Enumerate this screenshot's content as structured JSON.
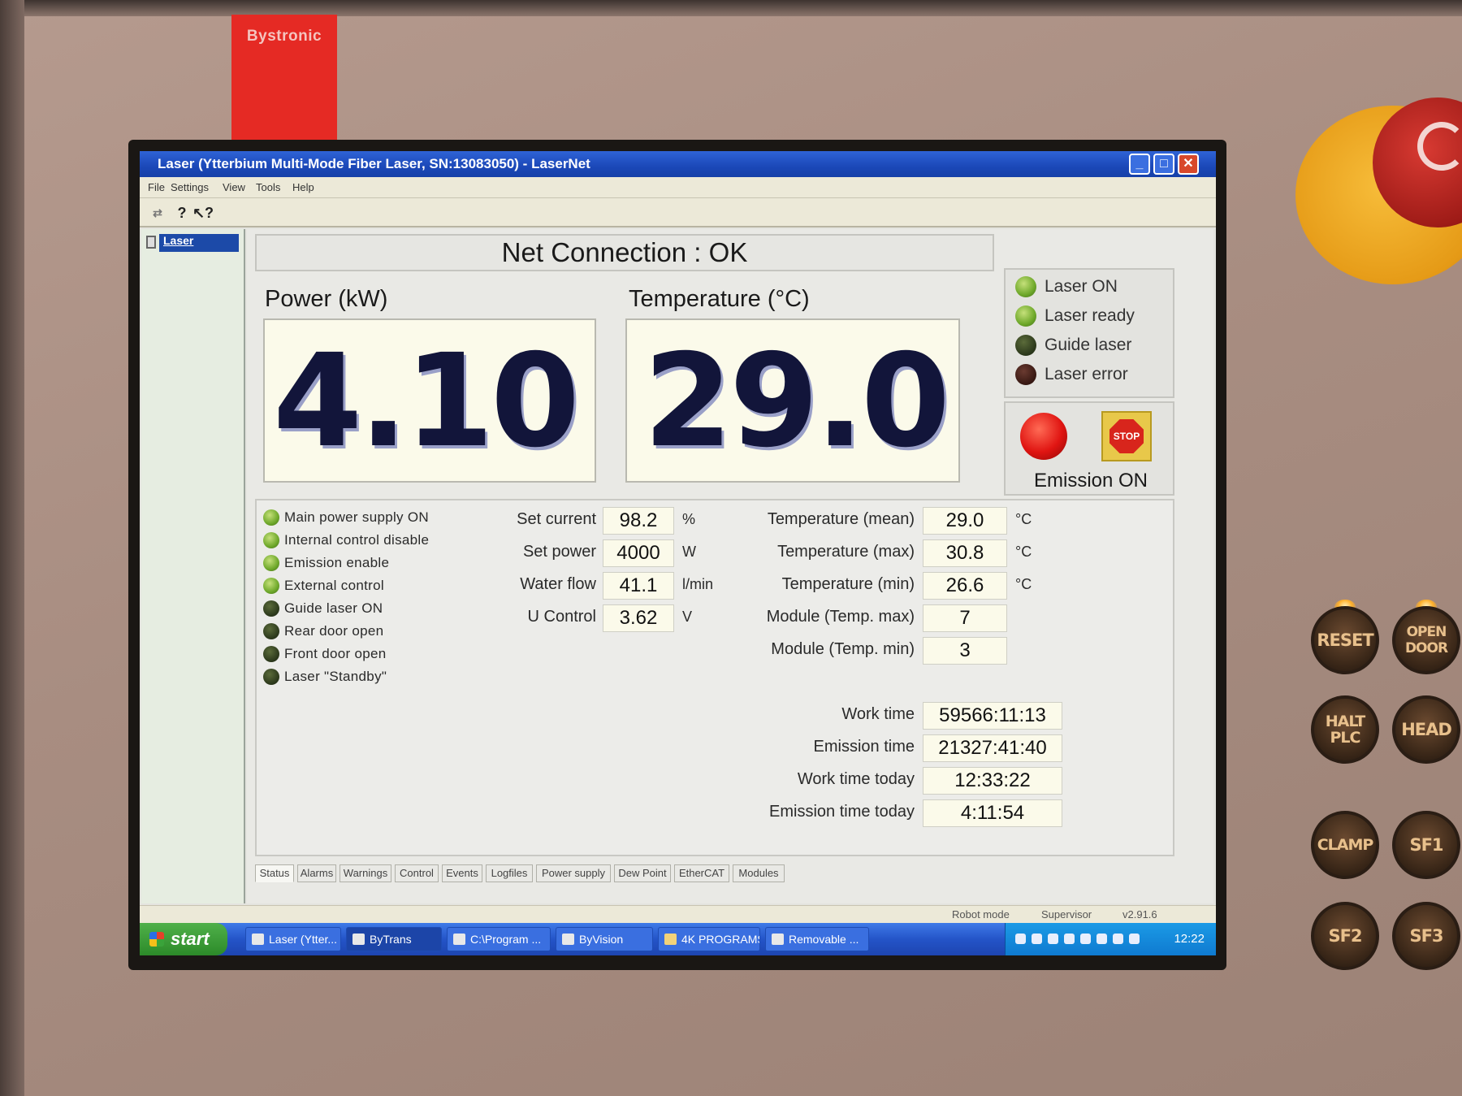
{
  "hardware": {
    "brand": "Bystronic",
    "buttons": [
      {
        "name": "reset-button",
        "label": "RESET"
      },
      {
        "name": "open-door-button",
        "label": "OPEN DOOR"
      },
      {
        "name": "halt-plc-button",
        "label": "HALT PLC"
      },
      {
        "name": "head-button",
        "label": "HEAD"
      },
      {
        "name": "clamp-button",
        "label": "CLAMP"
      },
      {
        "name": "sf1-button",
        "label": "SF1"
      },
      {
        "name": "sf2-button",
        "label": "SF2"
      },
      {
        "name": "sf3-button",
        "label": "SF3"
      }
    ]
  },
  "window": {
    "title": "Laser (Ytterbium Multi-Mode Fiber Laser, SN:13083050) - LaserNet",
    "controls": {
      "minimize": "_",
      "maximize": "□",
      "close": "✕"
    }
  },
  "menu": [
    "File",
    "Settings",
    "View",
    "Tools",
    "Help"
  ],
  "toolbar_icons": [
    "connect-icon",
    "help-icon",
    "context-help-icon"
  ],
  "tree": {
    "item": "Laser"
  },
  "main": {
    "net_connection": "Net Connection : OK",
    "power_label": "Power (kW)",
    "power_value": "4.10",
    "temperature_label": "Temperature (°C)",
    "temperature_value": "29.0",
    "status_indicators": [
      {
        "label": "Laser ON",
        "state": "on",
        "color": "#6ea82a"
      },
      {
        "label": "Laser ready",
        "state": "on",
        "color": "#6ea82a"
      },
      {
        "label": "Guide laser",
        "state": "off",
        "color": "#2d3a1c"
      },
      {
        "label": "Laser error",
        "state": "off",
        "color": "#3a1a14"
      }
    ],
    "emission_label": "Emission ON",
    "stop_label": "STOP"
  },
  "flags": [
    {
      "label": "Main power supply ON",
      "state": "on"
    },
    {
      "label": "Internal control disable",
      "state": "on"
    },
    {
      "label": "Emission enable",
      "state": "on"
    },
    {
      "label": "External control",
      "state": "on"
    },
    {
      "label": "Guide laser ON",
      "state": "off"
    },
    {
      "label": "Rear door open",
      "state": "off"
    },
    {
      "label": "Front door open",
      "state": "off"
    },
    {
      "label": "Laser \"Standby\"",
      "state": "off"
    }
  ],
  "settings": [
    {
      "label": "Set current",
      "value": "98.2",
      "unit": "%"
    },
    {
      "label": "Set power",
      "value": "4000",
      "unit": "W"
    },
    {
      "label": "Water flow",
      "value": "41.1",
      "unit": "l/min"
    },
    {
      "label": "U Control",
      "value": "3.62",
      "unit": "V"
    }
  ],
  "temperatures": [
    {
      "label": "Temperature (mean)",
      "value": "29.0",
      "unit": "°C"
    },
    {
      "label": "Temperature (max)",
      "value": "30.8",
      "unit": "°C"
    },
    {
      "label": "Temperature (min)",
      "value": "26.6",
      "unit": "°C"
    },
    {
      "label": "Module (Temp. max)",
      "value": "7",
      "unit": ""
    },
    {
      "label": "Module (Temp. min)",
      "value": "3",
      "unit": ""
    }
  ],
  "times": [
    {
      "label": "Work time",
      "value": "59566:11:13"
    },
    {
      "label": "Emission time",
      "value": "21327:41:40"
    },
    {
      "label": "Work time today",
      "value": "12:33:22"
    },
    {
      "label": "Emission time today",
      "value": "4:11:54"
    }
  ],
  "tabs": [
    "Status",
    "Alarms",
    "Warnings",
    "Control",
    "Events",
    "Logfiles",
    "Power supply",
    "Dew Point",
    "EtherCAT",
    "Modules"
  ],
  "active_tab": "Status",
  "statusbar": {
    "mode": "Robot mode",
    "user": "Supervisor",
    "version": "v2.91.6"
  },
  "taskbar": {
    "start": "start",
    "items": [
      "Laser (Ytter...",
      "ByTrans",
      "C:\\Program ...",
      "ByVision",
      "4K PROGRAMS",
      "Removable ..."
    ],
    "active_item": "ByTrans",
    "clock": "12:22"
  },
  "colors": {
    "accent": "#1c4aa8",
    "emission_led": "#e01512",
    "stop_button": "#d8251c"
  }
}
